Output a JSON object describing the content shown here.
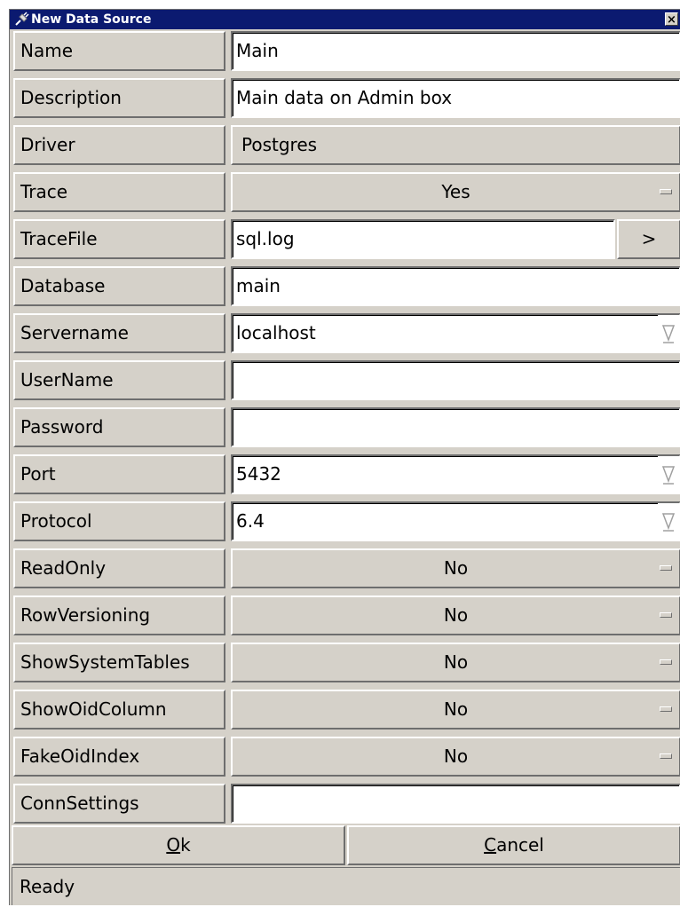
{
  "window": {
    "title": "New Data Source",
    "close_glyph": "×"
  },
  "fields": {
    "name": {
      "label": "Name",
      "value": "Main"
    },
    "description": {
      "label": "Description",
      "value": "Main data on Admin box"
    },
    "driver": {
      "label": "Driver",
      "value": "Postgres"
    },
    "trace": {
      "label": "Trace",
      "value": "Yes"
    },
    "tracefile": {
      "label": "TraceFile",
      "value": "sql.log",
      "browse_label": ">"
    },
    "database": {
      "label": "Database",
      "value": "main"
    },
    "servername": {
      "label": "Servername",
      "value": "localhost"
    },
    "username": {
      "label": "UserName",
      "value": ""
    },
    "password": {
      "label": "Password",
      "value": ""
    },
    "port": {
      "label": "Port",
      "value": "5432"
    },
    "protocol": {
      "label": "Protocol",
      "value": "6.4"
    },
    "readonly": {
      "label": "ReadOnly",
      "value": "No"
    },
    "rowversioning": {
      "label": "RowVersioning",
      "value": "No"
    },
    "showsystemtables": {
      "label": "ShowSystemTables",
      "value": "No"
    },
    "showoidcolumn": {
      "label": "ShowOidColumn",
      "value": "No"
    },
    "fakeoidindex": {
      "label": "FakeOidIndex",
      "value": "No"
    },
    "connsettings": {
      "label": "ConnSettings",
      "value": ""
    }
  },
  "buttons": {
    "ok": {
      "mnemonic": "O",
      "rest": "k"
    },
    "cancel": {
      "mnemonic": "C",
      "rest": "ancel"
    }
  },
  "status": {
    "text": "Ready"
  },
  "icons": {
    "title": "plug-icon",
    "combo": "chevron-down-icon",
    "option": "option-indicator-icon"
  },
  "colors": {
    "titlebar": "#0b1a70",
    "face": "#d5d1c9",
    "entry": "#ffffff"
  }
}
